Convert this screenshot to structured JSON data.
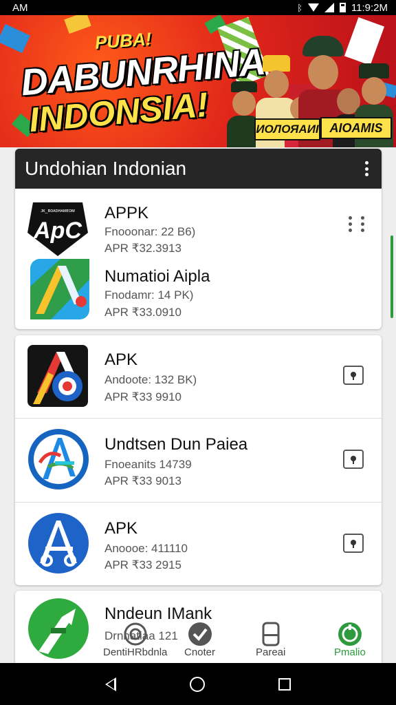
{
  "status_bar": {
    "time_left": "AM",
    "time_right": "11:9:2M"
  },
  "banner": {
    "small_text": "PUBA!",
    "line1": "DABUNRHINA",
    "line2": "INDONSIA!",
    "tag1": "ИОЛОЯАИI",
    "tag2": "AIOAMIS"
  },
  "list_card": {
    "title": "Undohian Indonian",
    "items": [
      {
        "icon_text": "ApC",
        "icon_caption": "ᴊᴋ_ʙᴏᴀᴅʜᴀᴍᴇᴏᴍ",
        "name": "APPK",
        "meta": "Fnooonar: 22 B6)",
        "version": "APR ₹32.3913"
      },
      {
        "name": "Numatioi Aipla",
        "meta": "Fnodamr: 14 PK)",
        "version": "APR ₹33.0910"
      }
    ]
  },
  "apps": [
    {
      "name": "APK",
      "meta": "Andoote: 132 BK)",
      "version": "APR ₹33 9910"
    },
    {
      "name": "Undtsen Dun Paiea",
      "meta": "Fnoeanits 14739",
      "version": "APR ₹33 9013"
    },
    {
      "name": "APK",
      "meta": "Anoooe: 411110",
      "version": "APR ₹33 2915"
    },
    {
      "name": "Nndeun IMank",
      "meta": "Drnhatiaa 121",
      "version": ""
    }
  ],
  "bottom_nav": [
    {
      "label": "DentiHRbdnla"
    },
    {
      "label": "Cnoter"
    },
    {
      "label": "Pareai"
    },
    {
      "label": "Pmalio"
    }
  ],
  "colors": {
    "accent_green": "#2e9a3e",
    "banner_red": "#e0261a",
    "banner_yellow": "#ffe14a"
  }
}
